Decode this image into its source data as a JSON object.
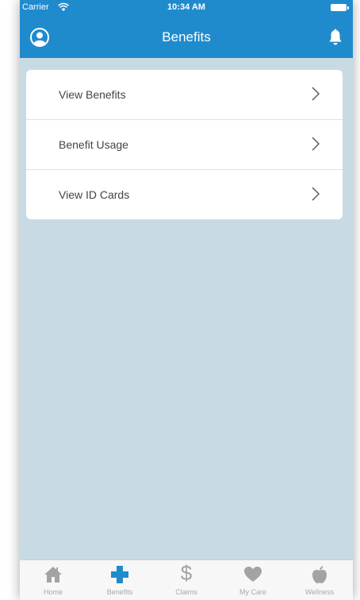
{
  "status_bar": {
    "carrier": "Carrier",
    "time": "10:34 AM"
  },
  "nav": {
    "title": "Benefits",
    "profile_icon": "user-circle-icon",
    "bell_icon": "bell-icon"
  },
  "menu": {
    "items": [
      {
        "label": "View Benefits"
      },
      {
        "label": "Benefit Usage"
      },
      {
        "label": "View ID Cards"
      }
    ]
  },
  "tab_bar": {
    "tabs": [
      {
        "label": "Home",
        "icon": "home-icon",
        "active": false
      },
      {
        "label": "Benefits",
        "icon": "cross-icon",
        "active": true
      },
      {
        "label": "Claims",
        "icon": "dollar-icon",
        "active": false
      },
      {
        "label": "My Care",
        "icon": "heart-icon",
        "active": false
      },
      {
        "label": "Wellness",
        "icon": "apple-icon",
        "active": false
      }
    ]
  },
  "colors": {
    "brand": "#1f8bcd",
    "background": "#c8dbe4",
    "inactive_icon": "#a3a3a3"
  }
}
